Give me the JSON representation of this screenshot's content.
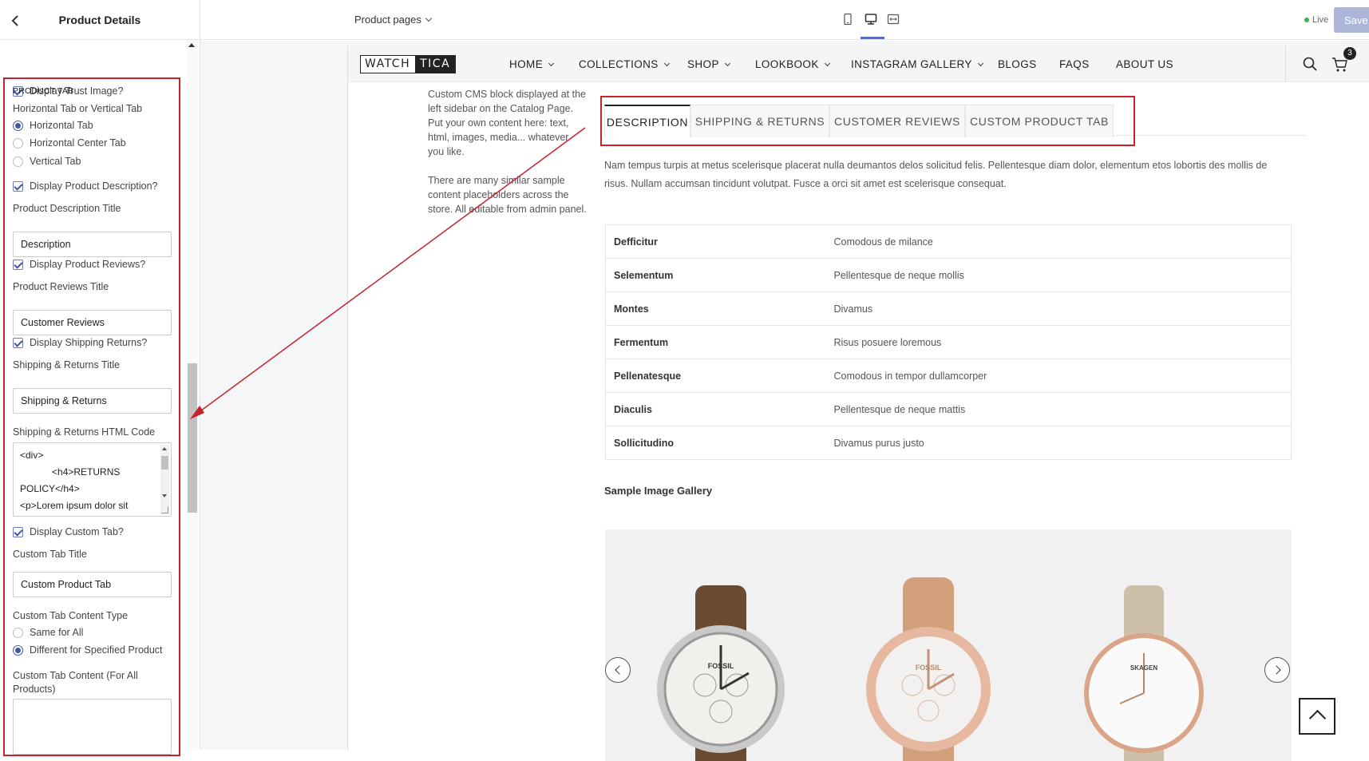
{
  "editor": {
    "title": "Product Details",
    "trust_image_label": "Display Trust Image?",
    "product_tab_section": "PRODUCT TAB",
    "tab_layout_label": "Horizontal Tab or Vertical Tab",
    "tab_layout_options": [
      "Horizontal Tab",
      "Horizontal Center Tab",
      "Vertical Tab"
    ],
    "display_description_label": "Display Product Description?",
    "description_title_label": "Product Description Title",
    "description_title_value": "Description",
    "display_reviews_label": "Display Product Reviews?",
    "reviews_title_label": "Product Reviews Title",
    "reviews_title_value": "Customer Reviews",
    "display_shipping_label": "Display Shipping Returns?",
    "shipping_title_label": "Shipping & Returns Title",
    "shipping_title_value": "Shipping & Returns",
    "shipping_html_label": "Shipping & Returns HTML Code",
    "shipping_html_value": "<div>\n            <h4>RETURNS\nPOLICY</h4>\n<p>Lorem ipsum dolor sit",
    "display_custom_label": "Display Custom Tab?",
    "custom_title_label": "Custom Tab Title",
    "custom_title_value": "Custom Product Tab",
    "custom_type_label": "Custom Tab Content Type",
    "custom_type_options": [
      "Same for All",
      "Different for Specified Product"
    ],
    "custom_content_label": "Custom Tab Content (For All Products)"
  },
  "topbar": {
    "page_select": "Product pages",
    "live_label": "Live",
    "save_label": "Save"
  },
  "site": {
    "logo_left": "WATCH",
    "logo_right": "TICA",
    "nav": [
      "HOME",
      "COLLECTIONS",
      "SHOP",
      "LOOKBOOK",
      "INSTAGRAM GALLERY",
      "BLOGS",
      "FAQS",
      "ABOUT US"
    ],
    "cart_count": "3",
    "cms_text_1": "Custom CMS block displayed at the left sidebar on the Catalog Page. Put your own content here: text, html, images, media... whatever you like.",
    "cms_text_2": "There are many similar sample content placeholders across the store. All editable from admin panel.",
    "tabs": [
      "DESCRIPTION",
      "SHIPPING & RETURNS",
      "CUSTOMER REVIEWS",
      "CUSTOM PRODUCT TAB"
    ],
    "description": "Nam tempus turpis at metus scelerisque placerat nulla deumantos delos solicitud felis. Pellentesque diam dolor, elementum etos lobortis des mollis de risus. Nullam accumsan tincidunt volutpat. Fusce a orci sit amet est scelerisque consequat.",
    "specs": [
      {
        "k": "Defficitur",
        "v": "Comodous de milance"
      },
      {
        "k": "Selementum",
        "v": "Pellentesque de neque mollis"
      },
      {
        "k": "Montes",
        "v": "Divamus"
      },
      {
        "k": "Fermentum",
        "v": "Risus posuere loremous"
      },
      {
        "k": "Pellenatesque",
        "v": "Comodous in tempor dullamcorper"
      },
      {
        "k": "Diaculis",
        "v": "Pellentesque de neque mattis"
      },
      {
        "k": "Sollicitudino",
        "v": "Divamus purus justo"
      }
    ],
    "gallery_title": "Sample Image Gallery",
    "watch_brands": [
      "FOSSIL",
      "FOSSIL",
      "SKAGEN"
    ]
  },
  "colors": {
    "accent": "#47559d",
    "annotation_red": "#c8232c",
    "save_disabled": "#aeb5db",
    "live_green": "#3cb04a"
  }
}
